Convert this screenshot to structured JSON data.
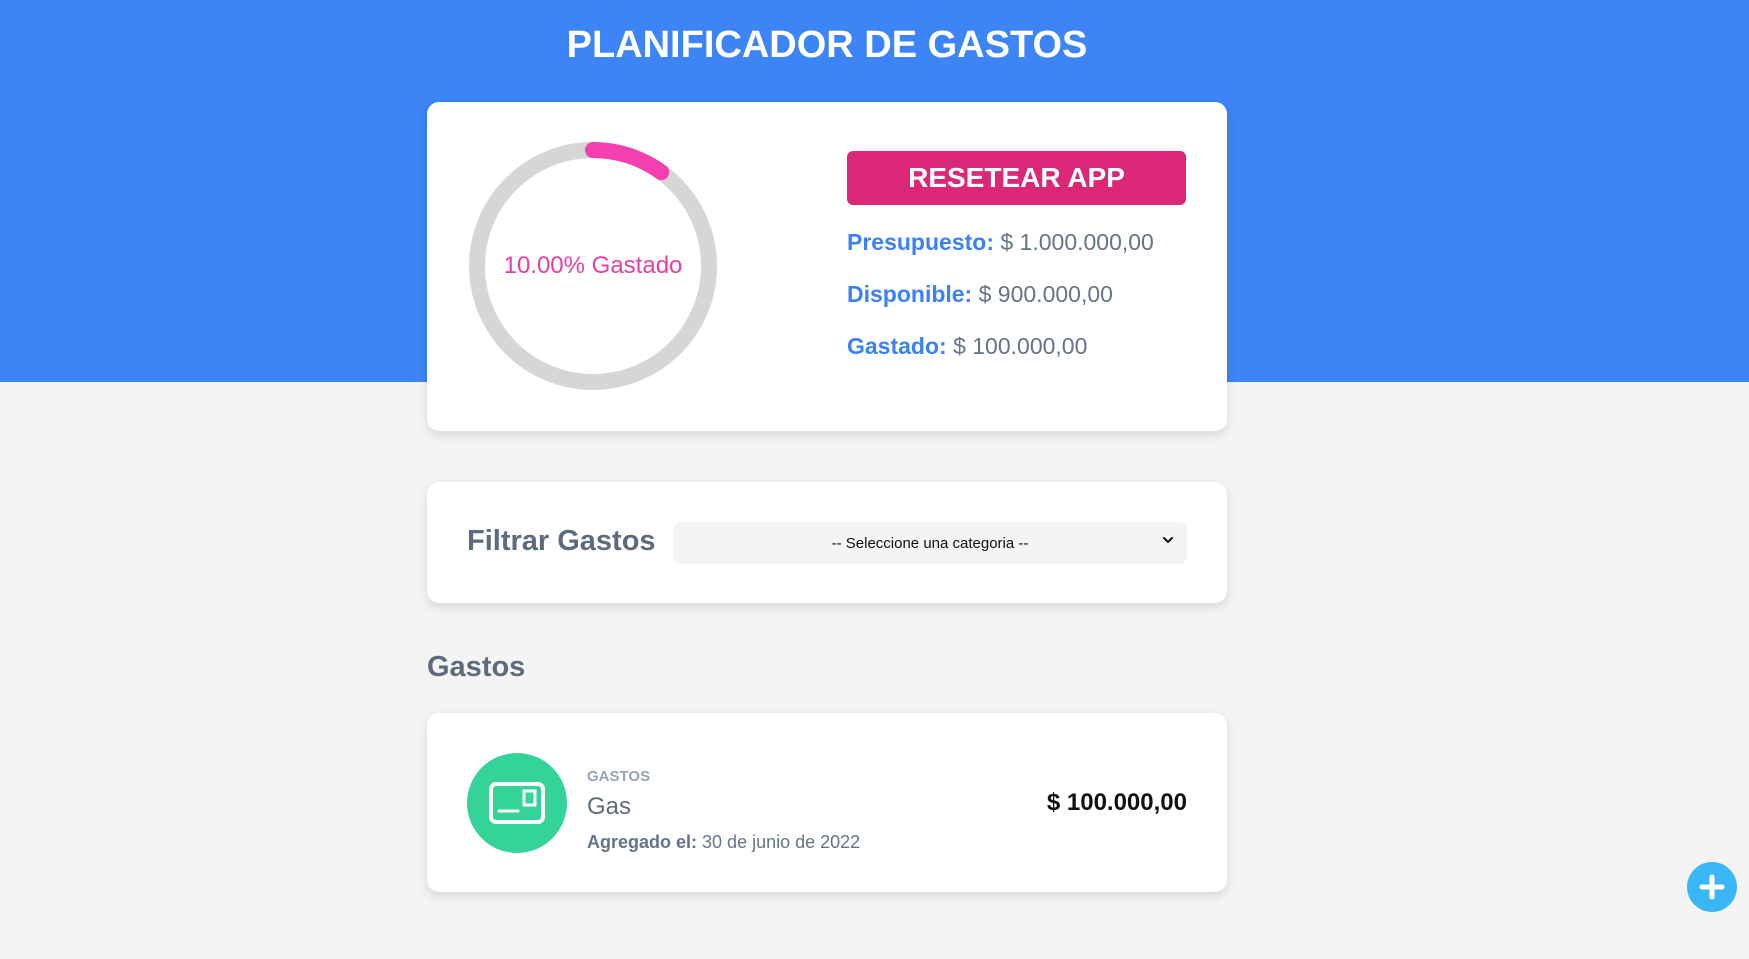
{
  "header": {
    "title": "PLANIFICADOR DE GASTOS"
  },
  "budget": {
    "percent_spent": 10,
    "ring_label": "10.00% Gastado",
    "reset_label": "RESETEAR APP",
    "presupuesto_label": "Presupuesto:",
    "presupuesto_value": "$ 1.000.000,00",
    "disponible_label": "Disponible:",
    "disponible_value": "$ 900.000,00",
    "gastado_label": "Gastado:",
    "gastado_value": "$ 100.000,00",
    "colors": {
      "ring_progress": "#f43fb0",
      "ring_track": "#d6d6d6",
      "reset_bg": "#db2777",
      "hero_bg": "#3d84f6"
    }
  },
  "filter": {
    "label": "Filtrar Gastos",
    "selected": "-- Seleccione una categoria --"
  },
  "expenses": {
    "section_title": "Gastos",
    "items": [
      {
        "category": "GASTOS",
        "name": "Gas",
        "date_label": "Agregado el:",
        "date_value": "30 de junio de 2022",
        "amount": "$ 100.000,00",
        "icon": "card-icon",
        "icon_bg": "#34d399"
      }
    ]
  },
  "fab": {
    "icon": "plus-icon",
    "color": "#38b6f5"
  }
}
